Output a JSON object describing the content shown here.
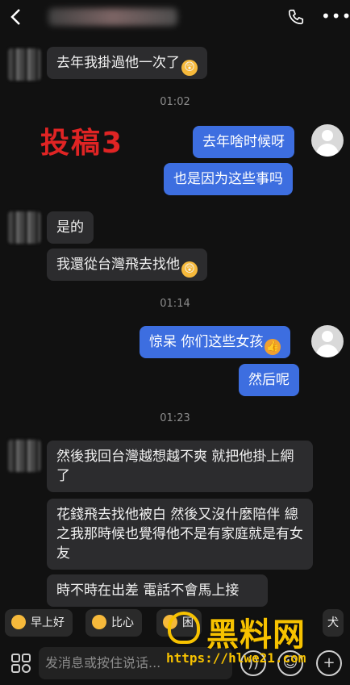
{
  "header": {
    "back_icon": "back-arrow-icon",
    "call_icon": "phone-icon",
    "more_icon": "more-icon"
  },
  "watermark_title": "投稿3",
  "messages": [
    {
      "side": "in",
      "text": "去年我掛過他一次了",
      "emoji": true
    },
    {
      "time": "01:02"
    },
    {
      "side": "out",
      "text": "去年啥时候呀"
    },
    {
      "side": "out",
      "text": "也是因为这些事吗"
    },
    {
      "side": "in",
      "text": "是的"
    },
    {
      "side": "in",
      "text": "我還從台灣飛去找他",
      "emoji": true
    },
    {
      "time": "01:14"
    },
    {
      "side": "out",
      "text": "惊呆 你们这些女孩",
      "emoji": true
    },
    {
      "side": "out",
      "text": "然后呢"
    },
    {
      "time": "01:23"
    },
    {
      "side": "in",
      "text": "然後我回台灣越想越不爽 就把他掛上網了"
    },
    {
      "side": "in",
      "text": "花錢飛去找他被白 然後又沒什麼陪伴 總之我那時候也覺得他不是有家庭就是有女友"
    },
    {
      "side": "in",
      "text": "時不時在出差 電話不會馬上接"
    }
  ],
  "quick_replies": [
    "早上好",
    "比心",
    "困"
  ],
  "quick_reply_partial": "犬",
  "input": {
    "placeholder": "发消息或按住说话..."
  },
  "watermark_logo": {
    "text": "黑料网",
    "url": "https://hlwe21.com"
  },
  "colors": {
    "outgoing": "#3d6ee0",
    "incoming": "#2c2c2e",
    "background": "#111111"
  }
}
